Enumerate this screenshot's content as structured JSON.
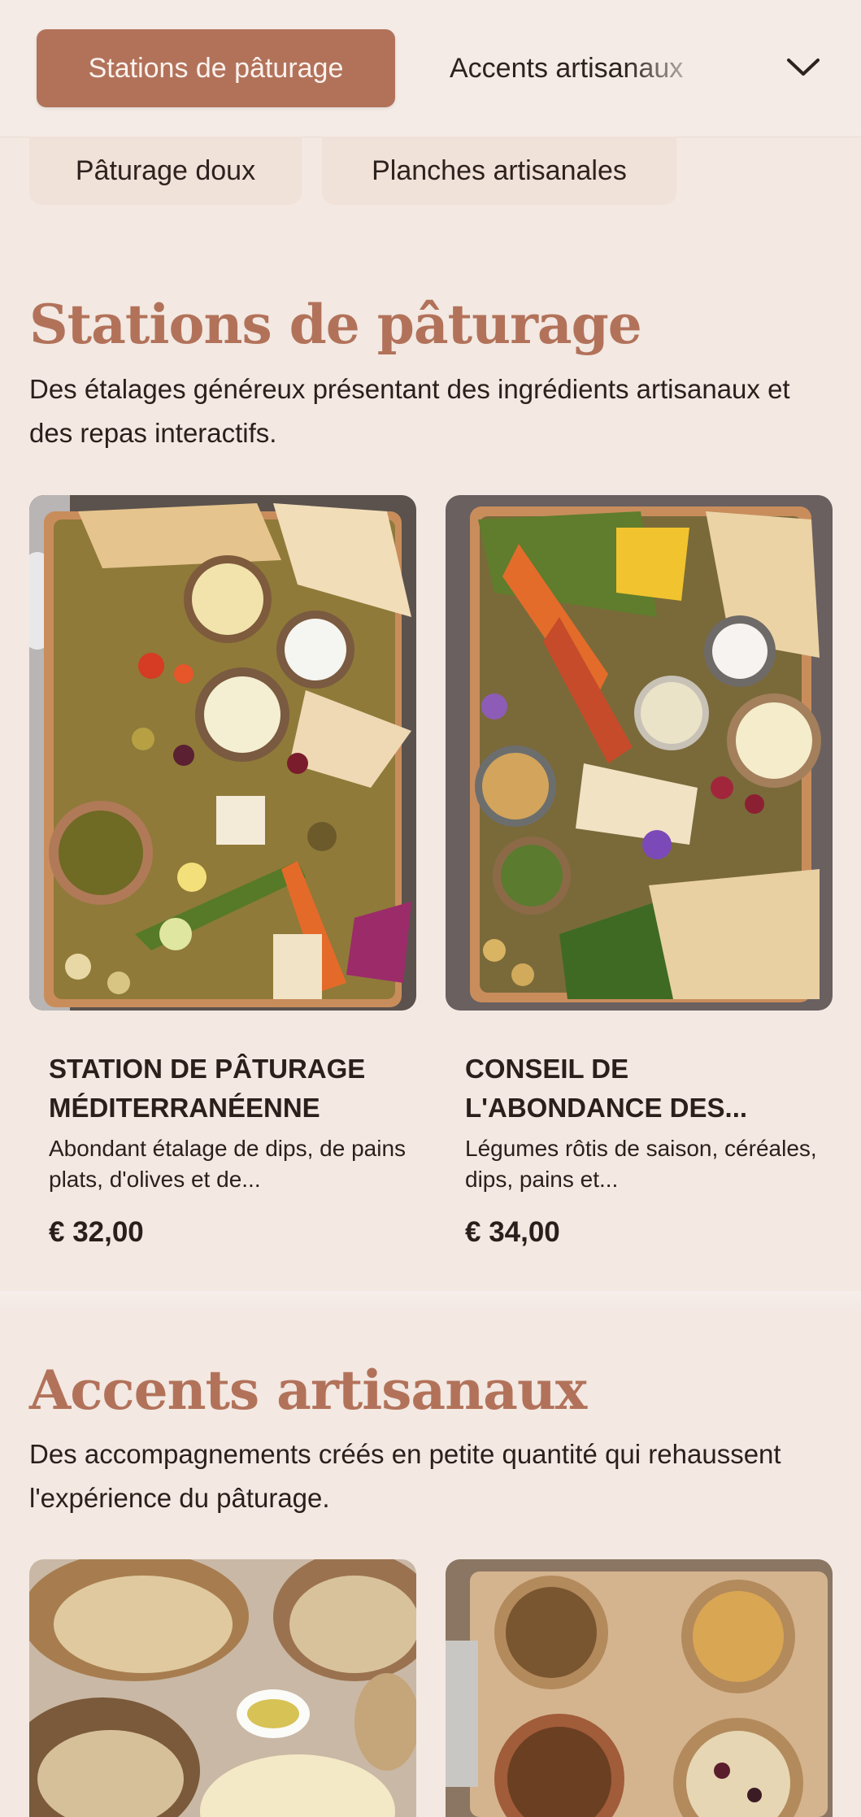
{
  "nav": {
    "tabs": [
      {
        "label": "Stations de pâturage",
        "active": true
      },
      {
        "label": "Accents artisanaux",
        "active": false
      }
    ],
    "dropdown_icon": "chevron-down-icon",
    "sub_tabs": [
      "Pâturage doux",
      "Planches artisanales"
    ],
    "accent_color": "#b2725a"
  },
  "sections": [
    {
      "title": "Stations de pâturage",
      "description": "Des étalages généreux présentant des ingrédients artisanaux et des repas interactifs.",
      "items": [
        {
          "title": "STATION DE PÂTURAGE MÉDITERRANÉENNE",
          "description": "Abondant étalage de dips, de pains plats, d'olives et de...",
          "price": "€ 32,00",
          "image": "mediterranean-grazing-board-photo"
        },
        {
          "title": "CONSEIL DE L'ABONDANCE DES...",
          "description": "Légumes rôtis de saison, céréales, dips, pains et...",
          "price": "€ 34,00",
          "image": "roasted-vegetable-board-photo"
        }
      ]
    },
    {
      "title": "Accents artisanaux",
      "description": "Des accompagnements créés en petite quantité qui rehaussent l'expérience du pâturage.",
      "items": [
        {
          "image": "artisan-bread-butter-photo"
        },
        {
          "image": "mixed-nuts-bowls-photo"
        }
      ]
    }
  ]
}
